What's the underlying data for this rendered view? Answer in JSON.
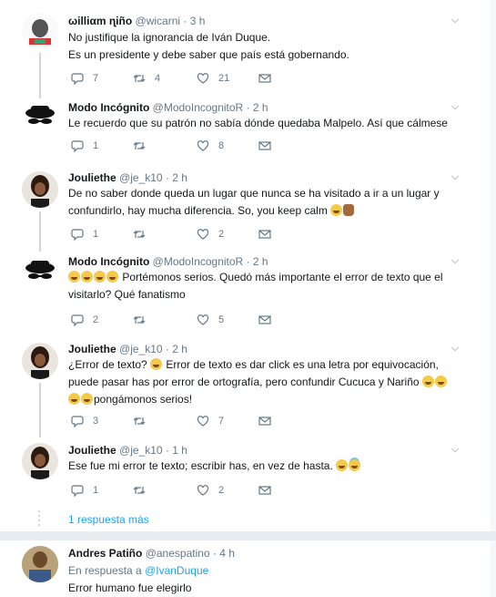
{
  "tweets": [
    {
      "name": "ωilliαm ɳiño",
      "handle": "@wicarni",
      "time": "· 3 h",
      "lines": [
        "No justifique la ignorancia de Iván Duque.",
        "Es un presidente y debe saber que país está gobernando."
      ],
      "replies": "7",
      "retweets": "4",
      "likes": "21"
    },
    {
      "name": "Modo Incógnito",
      "handle": "@ModoIncognitoR",
      "time": "· 2 h",
      "lines": [
        "Le recuerdo que su patrón no sabía dónde quedaba Malpelo. Así que cálmese"
      ],
      "replies": "1",
      "retweets": "",
      "likes": "8"
    },
    {
      "name": "Jouliethe",
      "handle": "@je_k10",
      "time": "· 2 h",
      "lines": [
        "De no saber donde queda un lugar que nunca se ha visitado a ir a un lugar y",
        "confundirlo, hay mucha diferencia. So, you keep calm"
      ],
      "replies": "1",
      "retweets": "",
      "likes": "2"
    },
    {
      "name": "Modo Incógnito",
      "handle": "@ModoIncognitoR",
      "time": "· 2 h",
      "line1_text": "Portémonos serios. Quedó más importante el error de texto que el",
      "line2_text": "visitarlo? Qué fanatismo",
      "replies": "2",
      "retweets": "",
      "likes": "5"
    },
    {
      "name": "Jouliethe",
      "handle": "@je_k10",
      "time": "· 2 h",
      "line1_a": "¿Error de texto?",
      "line1_b": "Error de texto es dar click es una letra por equivocación,",
      "line2": "puede pasar has por error de ortografía, pero confundir Cucuca y Nariño",
      "line3": "pongámonos serios!",
      "replies": "3",
      "retweets": "",
      "likes": "7"
    },
    {
      "name": "Jouliethe",
      "handle": "@je_k10",
      "time": "· 1 h",
      "line1": "Ese fue mi error te texto; escribir has, en vez de hasta.",
      "replies": "1",
      "retweets": "",
      "likes": "2"
    },
    {
      "name": "Andres Patiño",
      "handle": "@anespatino",
      "time": "· 4 h",
      "replying_prefix": "En respuesta a",
      "replying_to": "@IvanDuque",
      "line1": "Error humano fue elegirlo"
    }
  ],
  "more_replies": "1 respuesta más",
  "icons": [
    "reply-icon",
    "retweet-icon",
    "like-icon",
    "message-icon",
    "caret-down-icon"
  ],
  "colors": {
    "link": "#1da1f2",
    "muted": "#657786",
    "line": "#ccd6dd"
  }
}
